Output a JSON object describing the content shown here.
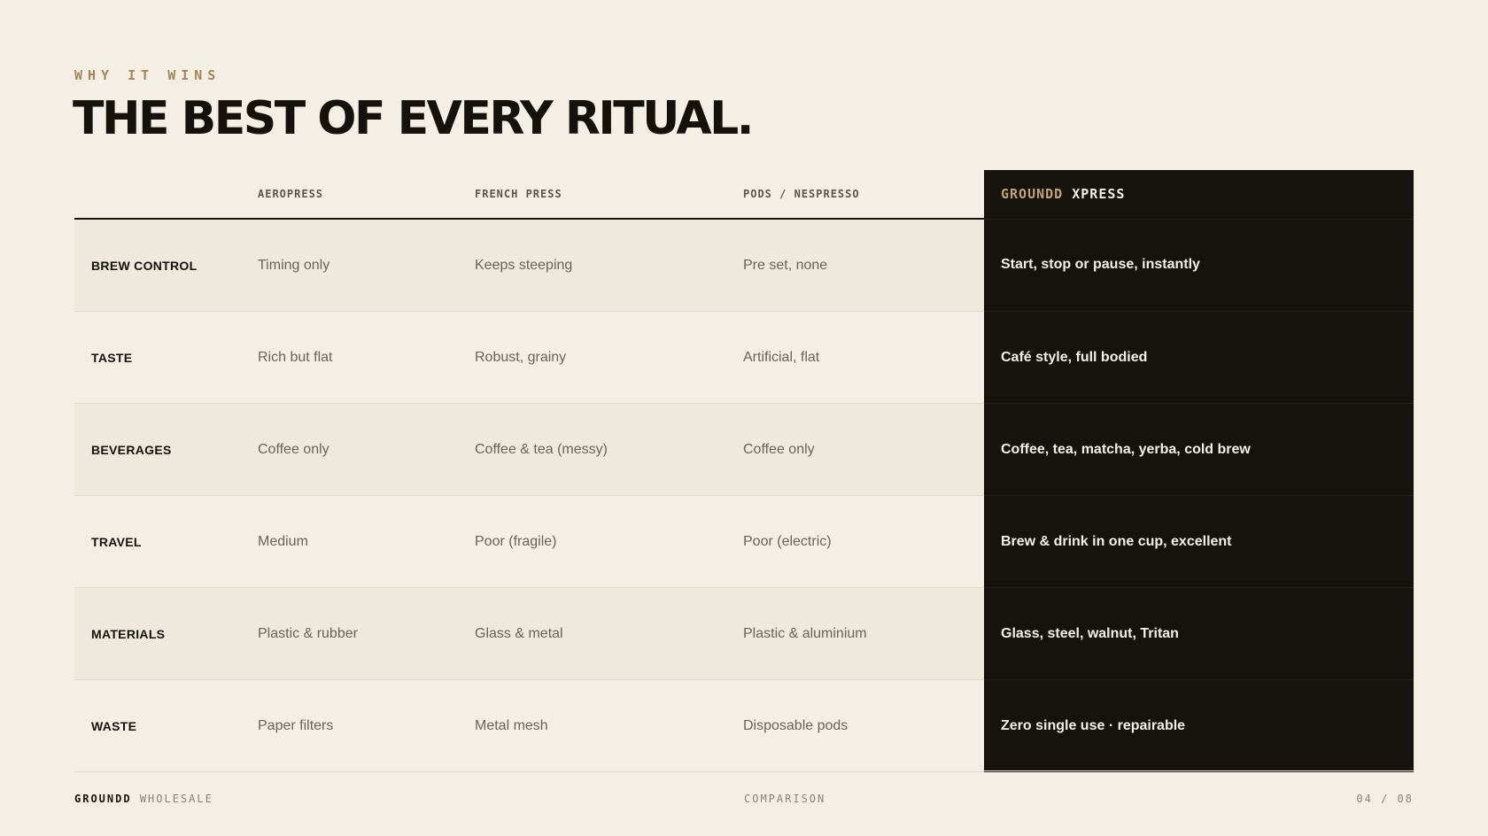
{
  "eyebrow": "WHY IT WINS",
  "title": "THE BEST OF EVERY RITUAL.",
  "table": {
    "headers": [
      "",
      "AEROPRESS",
      "FRENCH PRESS",
      "PODS / NESPRESSO"
    ],
    "highlight_header": {
      "brand": "GROUNDD",
      "product": "XPRESS"
    },
    "rows": [
      {
        "label": "BREW CONTROL",
        "cells": [
          "Timing only",
          "Keeps steeping",
          "Pre set, none"
        ],
        "highlight": "Start, stop or pause, instantly"
      },
      {
        "label": "TASTE",
        "cells": [
          "Rich but flat",
          "Robust, grainy",
          "Artificial, flat"
        ],
        "highlight": "Café style, full bodied"
      },
      {
        "label": "BEVERAGES",
        "cells": [
          "Coffee only",
          "Coffee & tea (messy)",
          "Coffee only"
        ],
        "highlight": "Coffee, tea, matcha, yerba, cold brew"
      },
      {
        "label": "TRAVEL",
        "cells": [
          "Medium",
          "Poor (fragile)",
          "Poor (electric)"
        ],
        "highlight": "Brew & drink in one cup, excellent"
      },
      {
        "label": "MATERIALS",
        "cells": [
          "Plastic & rubber",
          "Glass & metal",
          "Plastic & aluminium"
        ],
        "highlight": "Glass, steel, walnut, Tritan"
      },
      {
        "label": "WASTE",
        "cells": [
          "Paper filters",
          "Metal mesh",
          "Disposable pods"
        ],
        "highlight": "Zero single use · repairable"
      }
    ]
  },
  "footer": {
    "brand": "GROUNDD",
    "brand_suffix": "WHOLESALE",
    "section": "COMPARISON",
    "page": "04 / 08"
  },
  "colors": {
    "background": "#f4efe5",
    "ink": "#15120d",
    "accent": "#a88455",
    "highlight_background": "#16130e"
  }
}
